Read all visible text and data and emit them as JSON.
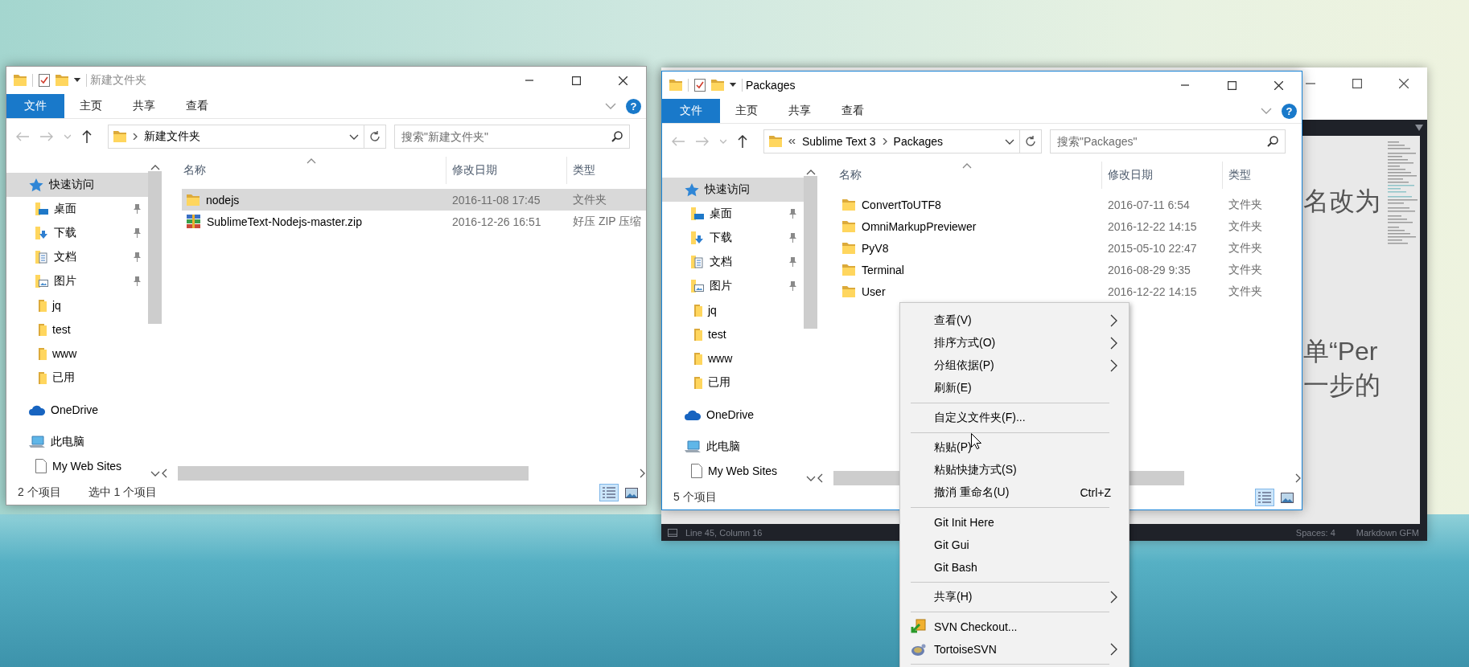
{
  "windows": [
    {
      "title": "新建文件夹",
      "active": false,
      "ribbon_tabs": [
        {
          "label": "文件",
          "kind": "file-menu"
        },
        {
          "label": "主页",
          "kind": "tab"
        },
        {
          "label": "共享",
          "kind": "tab"
        },
        {
          "label": "查看",
          "kind": "tab"
        }
      ],
      "help": "?",
      "address": {
        "overflow": false,
        "crumbs": [
          "新建文件夹"
        ]
      },
      "search": {
        "placeholder": "搜索\"新建文件夹\""
      },
      "nav": [
        {
          "label": "快速访问",
          "kind": "star",
          "pinned": false,
          "selected": true,
          "children": [
            {
              "label": "桌面",
              "kind": "desktop",
              "pinned": true,
              "selected": false
            },
            {
              "label": "下载",
              "kind": "download",
              "pinned": true,
              "selected": false
            },
            {
              "label": "文档",
              "kind": "document",
              "pinned": true,
              "selected": false
            },
            {
              "label": "图片",
              "kind": "picture",
              "pinned": true,
              "selected": false
            },
            {
              "label": "jq",
              "kind": "folder",
              "pinned": false,
              "selected": false
            },
            {
              "label": "test",
              "kind": "folder",
              "pinned": false,
              "selected": false
            },
            {
              "label": "www",
              "kind": "folder",
              "pinned": false,
              "selected": false
            },
            {
              "label": "已用",
              "kind": "folder",
              "pinned": false,
              "selected": false
            }
          ]
        },
        {
          "label": "OneDrive",
          "kind": "cloud",
          "pinned": false,
          "selected": false
        },
        {
          "label": "此电脑",
          "kind": "pc",
          "pinned": false,
          "selected": false,
          "children": [
            {
              "label": "My Web Sites",
              "kind": "file",
              "pinned": false,
              "selected": false
            }
          ]
        }
      ],
      "columns": [
        "名称",
        "修改日期",
        "类型"
      ],
      "rows": [
        {
          "name": "nodejs",
          "date": "2016-11-08 17:45",
          "type": "文件夹",
          "kind": "folder",
          "selected": true
        },
        {
          "name": "SublimeText-Nodejs-master.zip",
          "date": "2016-12-26 16:51",
          "type": "好压 ZIP 压缩",
          "kind": "zip",
          "selected": false
        }
      ],
      "status": {
        "count": "2 个项目",
        "selection": "选中 1 个项目"
      },
      "view_modes": [
        {
          "kind": "details",
          "selected": true
        },
        {
          "kind": "thumbnails",
          "selected": false
        }
      ]
    },
    {
      "title": "Packages",
      "active": true,
      "ribbon_tabs": [
        {
          "label": "文件",
          "kind": "file-menu"
        },
        {
          "label": "主页",
          "kind": "tab"
        },
        {
          "label": "共享",
          "kind": "tab"
        },
        {
          "label": "查看",
          "kind": "tab"
        }
      ],
      "help": "?",
      "address": {
        "overflow": true,
        "crumbs": [
          "Sublime Text 3",
          "Packages"
        ]
      },
      "search": {
        "placeholder": "搜索\"Packages\""
      },
      "nav": [
        {
          "label": "快速访问",
          "kind": "star",
          "pinned": false,
          "selected": true,
          "children": [
            {
              "label": "桌面",
              "kind": "desktop",
              "pinned": true,
              "selected": false
            },
            {
              "label": "下载",
              "kind": "download",
              "pinned": true,
              "selected": false
            },
            {
              "label": "文档",
              "kind": "document",
              "pinned": true,
              "selected": false
            },
            {
              "label": "图片",
              "kind": "picture",
              "pinned": true,
              "selected": false
            },
            {
              "label": "jq",
              "kind": "folder",
              "pinned": false,
              "selected": false
            },
            {
              "label": "test",
              "kind": "folder",
              "pinned": false,
              "selected": false
            },
            {
              "label": "www",
              "kind": "folder",
              "pinned": false,
              "selected": false
            },
            {
              "label": "已用",
              "kind": "folder",
              "pinned": false,
              "selected": false
            }
          ]
        },
        {
          "label": "OneDrive",
          "kind": "cloud",
          "pinned": false,
          "selected": false
        },
        {
          "label": "此电脑",
          "kind": "pc",
          "pinned": false,
          "selected": false,
          "children": [
            {
              "label": "My Web Sites",
              "kind": "file",
              "pinned": false,
              "selected": false
            }
          ]
        }
      ],
      "columns": [
        "名称",
        "修改日期",
        "类型"
      ],
      "rows": [
        {
          "name": "ConvertToUTF8",
          "date": "2016-07-11 6:54",
          "type": "文件夹",
          "kind": "folder",
          "selected": false
        },
        {
          "name": "OmniMarkupPreviewer",
          "date": "2016-12-22 14:15",
          "type": "文件夹",
          "kind": "folder",
          "selected": false
        },
        {
          "name": "PyV8",
          "date": "2015-05-10 22:47",
          "type": "文件夹",
          "kind": "folder",
          "selected": false
        },
        {
          "name": "Terminal",
          "date": "2016-08-29 9:35",
          "type": "文件夹",
          "kind": "folder",
          "selected": false
        },
        {
          "name": "User",
          "date": "2016-12-22 14:15",
          "type": "文件夹",
          "kind": "folder",
          "selected": false
        }
      ],
      "status": {
        "count": "5 个项目"
      },
      "view_modes": [
        {
          "kind": "details",
          "selected": true
        },
        {
          "kind": "thumbnails",
          "selected": false
        }
      ]
    }
  ],
  "editor": {
    "text_lines": [
      "名改为",
      "单“Per",
      "一步的"
    ],
    "status_bar": {
      "position": "Line 45, Column 16",
      "indentation": "Spaces: 4",
      "syntax": "Markdown GFM"
    }
  },
  "context_menu": [
    {
      "kind": "item",
      "label": "查看(V)",
      "submenu": true
    },
    {
      "kind": "item",
      "label": "排序方式(O)",
      "submenu": true
    },
    {
      "kind": "item",
      "label": "分组依据(P)",
      "submenu": true
    },
    {
      "kind": "item",
      "label": "刷新(E)",
      "submenu": false
    },
    {
      "kind": "separator"
    },
    {
      "kind": "item",
      "label": "自定义文件夹(F)...",
      "submenu": false
    },
    {
      "kind": "separator"
    },
    {
      "kind": "item",
      "label": "粘贴(P)",
      "submenu": false
    },
    {
      "kind": "item",
      "label": "粘贴快捷方式(S)",
      "submenu": false
    },
    {
      "kind": "item",
      "label": "撤消 重命名(U)",
      "shortcut": "Ctrl+Z",
      "submenu": false
    },
    {
      "kind": "separator"
    },
    {
      "kind": "item",
      "label": "Git Init Here",
      "submenu": false
    },
    {
      "kind": "item",
      "label": "Git Gui",
      "submenu": false
    },
    {
      "kind": "item",
      "label": "Git Bash",
      "submenu": false
    },
    {
      "kind": "separator"
    },
    {
      "kind": "item",
      "label": "共享(H)",
      "submenu": true
    },
    {
      "kind": "separator"
    },
    {
      "kind": "checkout",
      "label": "SVN Checkout...",
      "submenu": false
    },
    {
      "kind": "tortoise",
      "label": "TortoiseSVN",
      "submenu": true
    },
    {
      "kind": "separator"
    }
  ]
}
